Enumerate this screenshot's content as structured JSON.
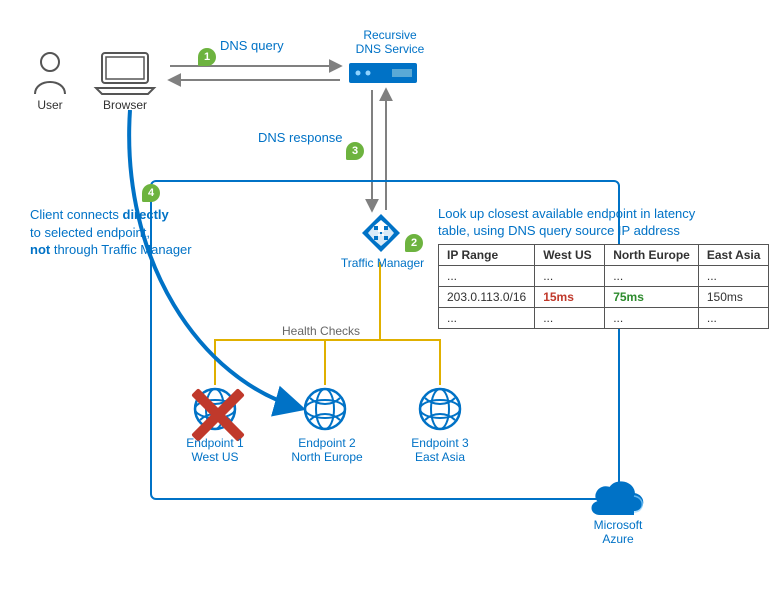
{
  "nodes": {
    "user_label": "User",
    "browser_label": "Browser",
    "dns_label1": "Recursive",
    "dns_label2": "DNS Service",
    "tm_label": "Traffic Manager",
    "ep1_l1": "Endpoint 1",
    "ep1_l2": "West US",
    "ep2_l1": "Endpoint 2",
    "ep2_l2": "North Europe",
    "ep3_l1": "Endpoint 3",
    "ep3_l2": "East Asia",
    "azure_l1": "Microsoft",
    "azure_l2": "Azure"
  },
  "steps": {
    "s1": {
      "num": "1",
      "text": "DNS query"
    },
    "s2": {
      "num": "2",
      "text_l1": "Look up closest available endpoint in latency",
      "text_l2": "table, using DNS query source IP address"
    },
    "s3": {
      "num": "3",
      "text": "DNS response"
    },
    "s4": {
      "num": "4",
      "line1a": "Client connects ",
      "line1b": "directly",
      "line2": "to selected endpoint,",
      "line3a": "not",
      "line3b": " through Traffic Manager"
    }
  },
  "health_checks_label": "Health Checks",
  "latency_table": {
    "headers": [
      "IP Range",
      "West US",
      "North Europe",
      "East Asia"
    ],
    "rows": [
      [
        "...",
        "...",
        "...",
        "..."
      ],
      [
        "203.0.113.0/16",
        "15ms",
        "75ms",
        "150ms"
      ],
      [
        "...",
        "...",
        "...",
        "..."
      ]
    ],
    "highlight_row": 1,
    "red_col": 1,
    "green_col": 2
  },
  "chart_data": {
    "type": "table",
    "title": "Traffic Manager Performance routing method flow",
    "flow": [
      "1 User/Browser sends DNS query to Recursive DNS Service",
      "2 Traffic Manager looks up closest available endpoint in latency table using DNS query source IP address",
      "3 DNS response returned via Recursive DNS Service",
      "4 Client connects directly to selected endpoint, not through Traffic Manager"
    ],
    "endpoints": [
      {
        "name": "Endpoint 1",
        "region": "West US",
        "healthy": false
      },
      {
        "name": "Endpoint 2",
        "region": "North Europe",
        "healthy": true,
        "selected": true
      },
      {
        "name": "Endpoint 3",
        "region": "East Asia",
        "healthy": true
      }
    ],
    "latency_lookup": {
      "ip_range_example": "203.0.113.0/16",
      "latencies_ms": {
        "West US": 15,
        "North Europe": 75,
        "East Asia": 150
      },
      "unavailable": [
        "West US"
      ],
      "chosen": "North Europe"
    }
  }
}
